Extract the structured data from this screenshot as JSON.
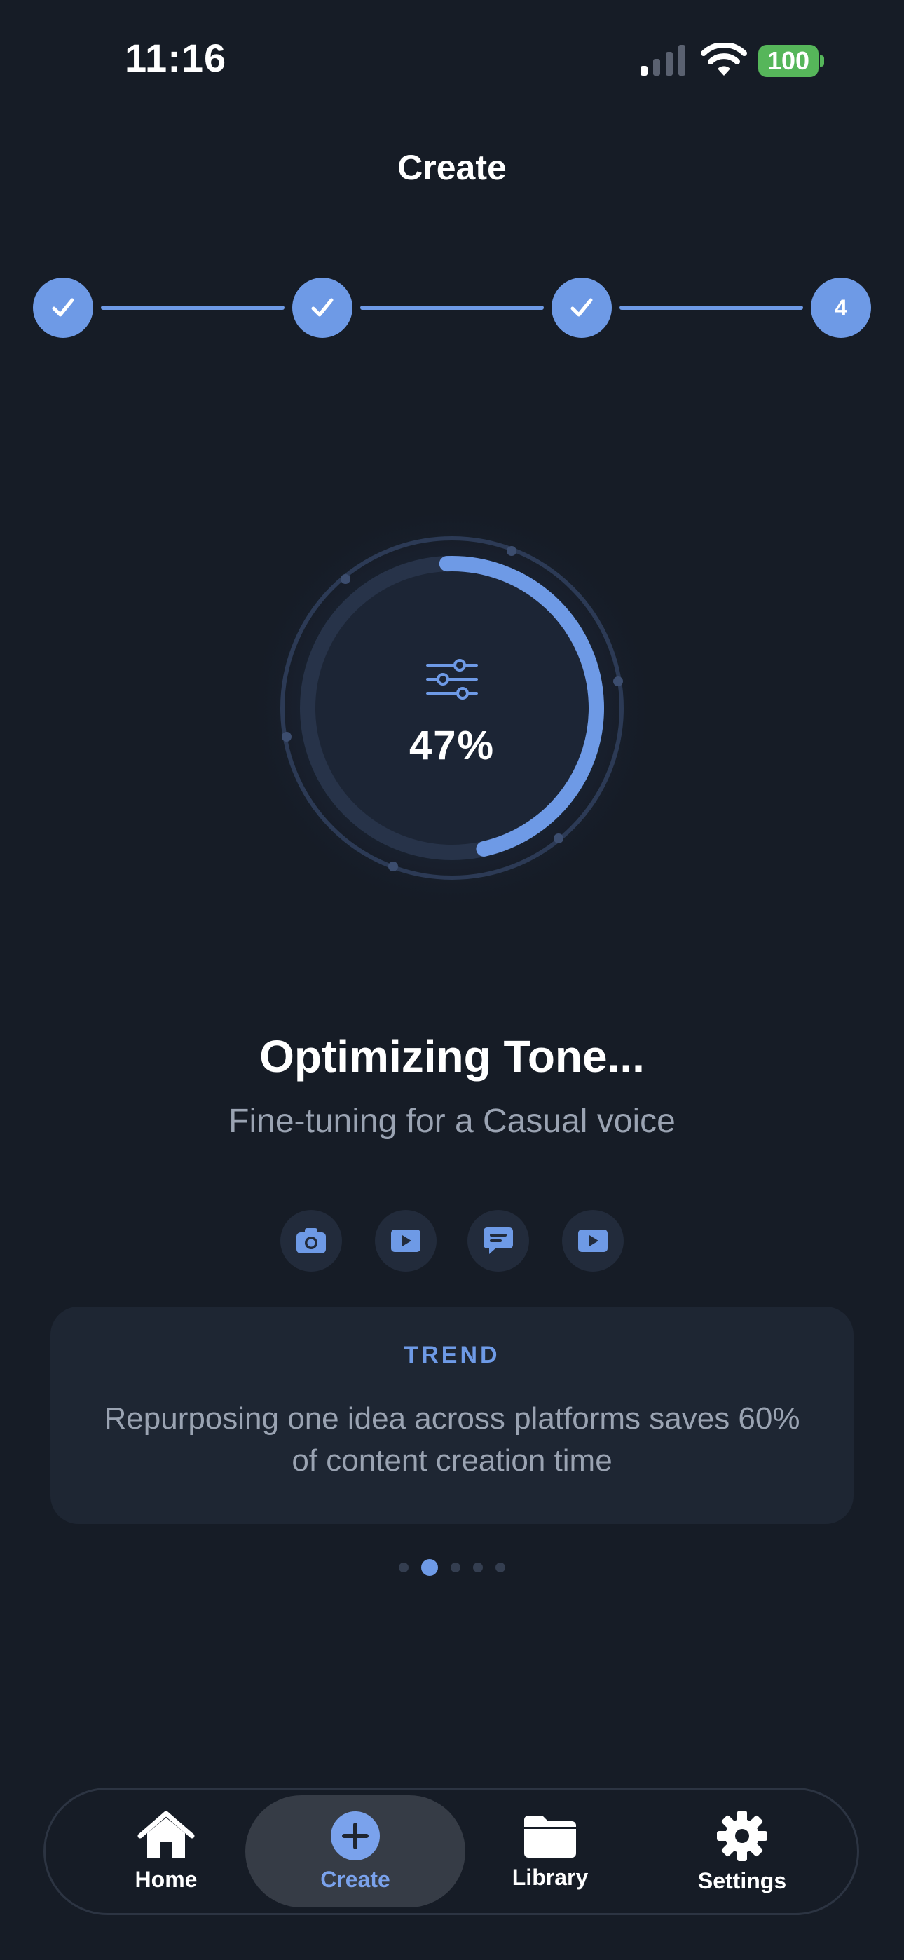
{
  "status_bar": {
    "time": "11:16",
    "battery": "100"
  },
  "header": {
    "title": "Create"
  },
  "stepper": {
    "steps": [
      "",
      "",
      "",
      "4"
    ],
    "completed": 3,
    "current_label": "4"
  },
  "progress": {
    "percent_label": "47%",
    "value": 0.47,
    "icon": "sliders-icon"
  },
  "status": {
    "headline": "Optimizing Tone...",
    "subline": "Fine-tuning for a Casual voice"
  },
  "platforms": [
    {
      "icon": "camera-icon"
    },
    {
      "icon": "video-play-icon"
    },
    {
      "icon": "chat-bubble-icon"
    },
    {
      "icon": "video-play-icon"
    }
  ],
  "tip_card": {
    "tag": "TREND",
    "text": "Repurposing one idea across platforms saves 60% of content creation time"
  },
  "pager": {
    "count": 5,
    "active_index": 1
  },
  "tabbar": {
    "items": [
      {
        "label": "Home",
        "icon": "home-icon"
      },
      {
        "label": "Create",
        "icon": "plus-circle-icon"
      },
      {
        "label": "Library",
        "icon": "folder-icon"
      },
      {
        "label": "Settings",
        "icon": "gear-icon"
      }
    ],
    "active": "Create"
  },
  "colors": {
    "background": "#161c26",
    "accent": "#6e9ae6",
    "battery": "#56b65a",
    "muted_text": "#9aa3b2"
  }
}
